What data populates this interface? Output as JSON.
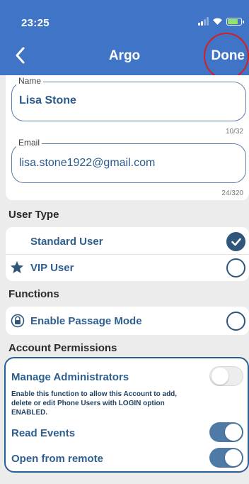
{
  "status_bar": {
    "time": "23:25"
  },
  "nav": {
    "title": "Argo",
    "done_label": "Done"
  },
  "form": {
    "name": {
      "label": "Name",
      "value": "Lisa Stone",
      "counter": "10/32"
    },
    "email": {
      "label": "Email",
      "value": "lisa.stone1922@gmail.com",
      "counter": "24/320"
    }
  },
  "user_type": {
    "heading": "User Type",
    "options": [
      {
        "label": "Standard User",
        "selected": true
      },
      {
        "label": "VIP User",
        "selected": false,
        "icon": "star-icon"
      }
    ]
  },
  "functions": {
    "heading": "Functions",
    "options": [
      {
        "label": "Enable Passage Mode",
        "selected": false,
        "icon": "lock-icon"
      }
    ]
  },
  "permissions": {
    "heading": "Account Permissions",
    "items": [
      {
        "label": "Manage Administrators",
        "enabled": false,
        "description": "Enable this function to allow this Account to add, delete or edit Phone Users with LOGIN option ENABLED."
      },
      {
        "label": "Read Events",
        "enabled": true
      },
      {
        "label": "Open from remote",
        "enabled": true
      }
    ]
  },
  "colors": {
    "header": "#3f74c6",
    "accent": "#30567c",
    "highlight_ring": "#d71f1f"
  }
}
